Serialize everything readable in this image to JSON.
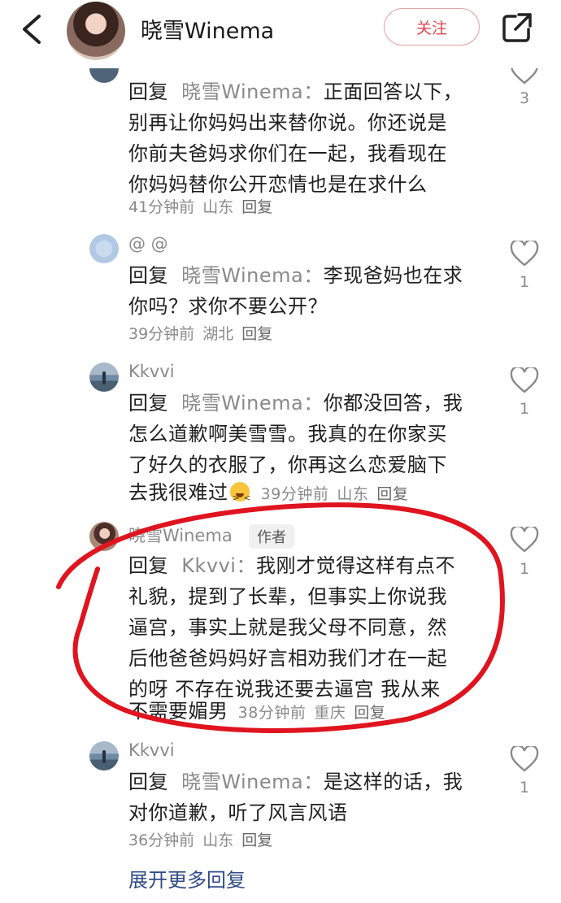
{
  "header": {
    "title": "晓雪Winema",
    "follow_label": "关注"
  },
  "comments": [
    {
      "lines": [
        "正面回答以下，",
        "别再让你妈妈出来替你说。你还说是",
        "你前夫爸妈求你们在一起，我看现在",
        "你妈妈替你公开恋情也是在求什么"
      ],
      "prefix": "回复",
      "target": "晓雪Winema：",
      "time": "41分钟前",
      "location": "山东",
      "reply": "回复",
      "likes": "3"
    },
    {
      "user": "@ @",
      "prefix": "回复",
      "target": "晓雪Winema：",
      "lines": [
        "李现爸妈也在求",
        "你吗？求你不要公开？"
      ],
      "time": "39分钟前",
      "location": "湖北",
      "reply": "回复",
      "likes": "1"
    },
    {
      "user": "Kkvvi",
      "prefix": "回复",
      "target": "晓雪Winema：",
      "lines": [
        "你都没回答，我",
        "怎么道歉啊美雪雪。我真的在你家买",
        "了好久的衣服了，你再这么恋爱脑下",
        "去我很难过"
      ],
      "time": "39分钟前",
      "location": "山东",
      "reply": "回复",
      "likes": "1"
    },
    {
      "user": "晓雪Winema",
      "badge": "作者",
      "prefix": "回复",
      "target": "Kkvvi：",
      "lines": [
        "我刚才觉得这样有点不",
        "礼貌，提到了长辈，但事实上你说我",
        "逼宫，事实上就是我父母不同意，然",
        "后他爸爸妈妈好言相劝我们才在一起",
        "的呀 不存在说我还要去逼宫 我从来",
        "不需要媚男"
      ],
      "time": "38分钟前",
      "location": "重庆",
      "reply": "回复",
      "likes": "1"
    },
    {
      "user": "Kkvvi",
      "prefix": "回复",
      "target": "晓雪Winema：",
      "lines": [
        "是这样的话，我",
        "对你道歉，听了风言风语"
      ],
      "time": "36分钟前",
      "location": "山东",
      "reply": "回复",
      "likes": "1"
    }
  ],
  "expand_more": "展开更多回复",
  "colors": {
    "accent_red": "#e0464f",
    "link_blue": "#2f4b87",
    "annotation_red": "#e0141e"
  }
}
